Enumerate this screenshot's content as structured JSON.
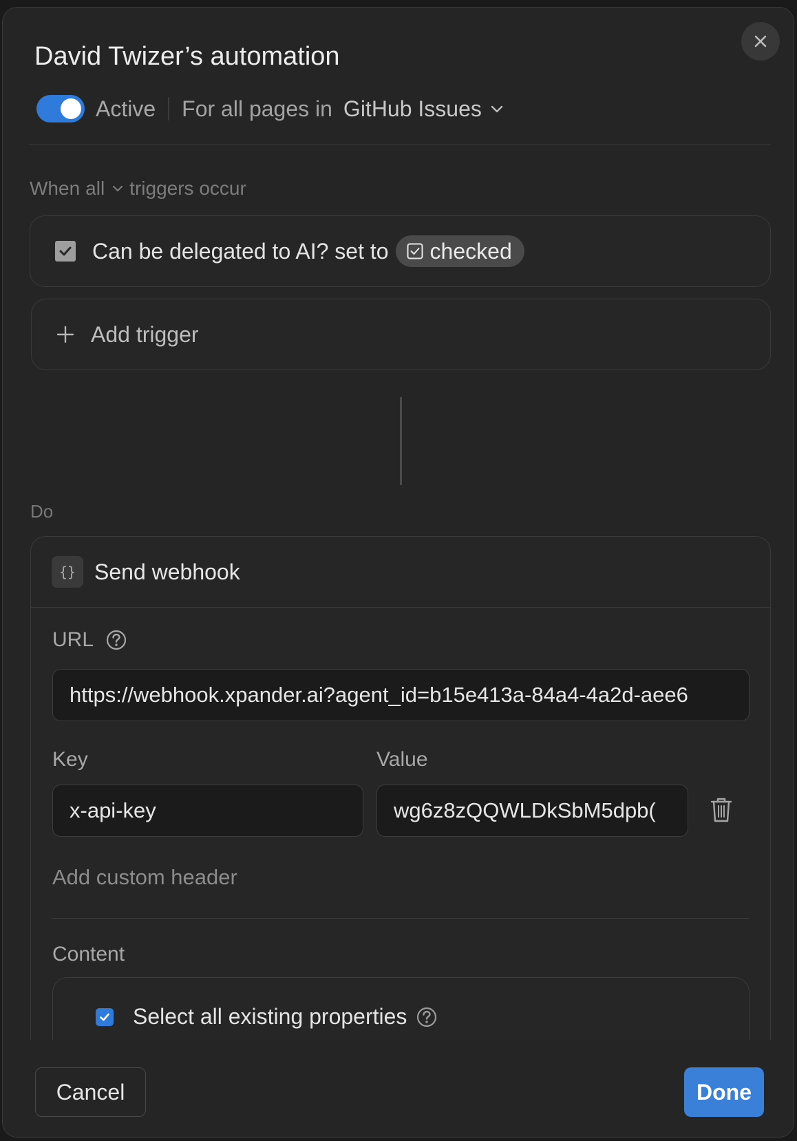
{
  "header": {
    "title": "David Twizer’s automation",
    "status_label": "Active",
    "toggle_on": true,
    "scope_prefix": "For all pages in",
    "database": "GitHub Issues"
  },
  "triggers": {
    "condition_prefix": "When",
    "condition_mode": "all",
    "condition_suffix": "triggers occur",
    "items": [
      {
        "text": "Can be delegated to AI? set to",
        "value": "checked"
      }
    ],
    "add_label": "Add trigger"
  },
  "actions": {
    "section_label": "Do",
    "webhook": {
      "title": "Send webhook",
      "icon_glyph": "{}",
      "url_label": "URL",
      "url_value": "https://webhook.xpander.ai?agent_id=b15e413a-84a4-4a2d-aee6",
      "key_label": "Key",
      "value_label": "Value",
      "header_key": "x-api-key",
      "header_value": "wg6z8zQQWLDkSbM5dpb(",
      "add_header_label": "Add custom header",
      "content_label": "Content",
      "select_all_label": "Select all existing properties"
    }
  },
  "footer": {
    "cancel_label": "Cancel",
    "done_label": "Done"
  },
  "colors": {
    "accent": "#2f7bdc",
    "done_button": "#3a7fd8",
    "modal_bg": "#252525",
    "input_bg": "#1b1b1b"
  }
}
